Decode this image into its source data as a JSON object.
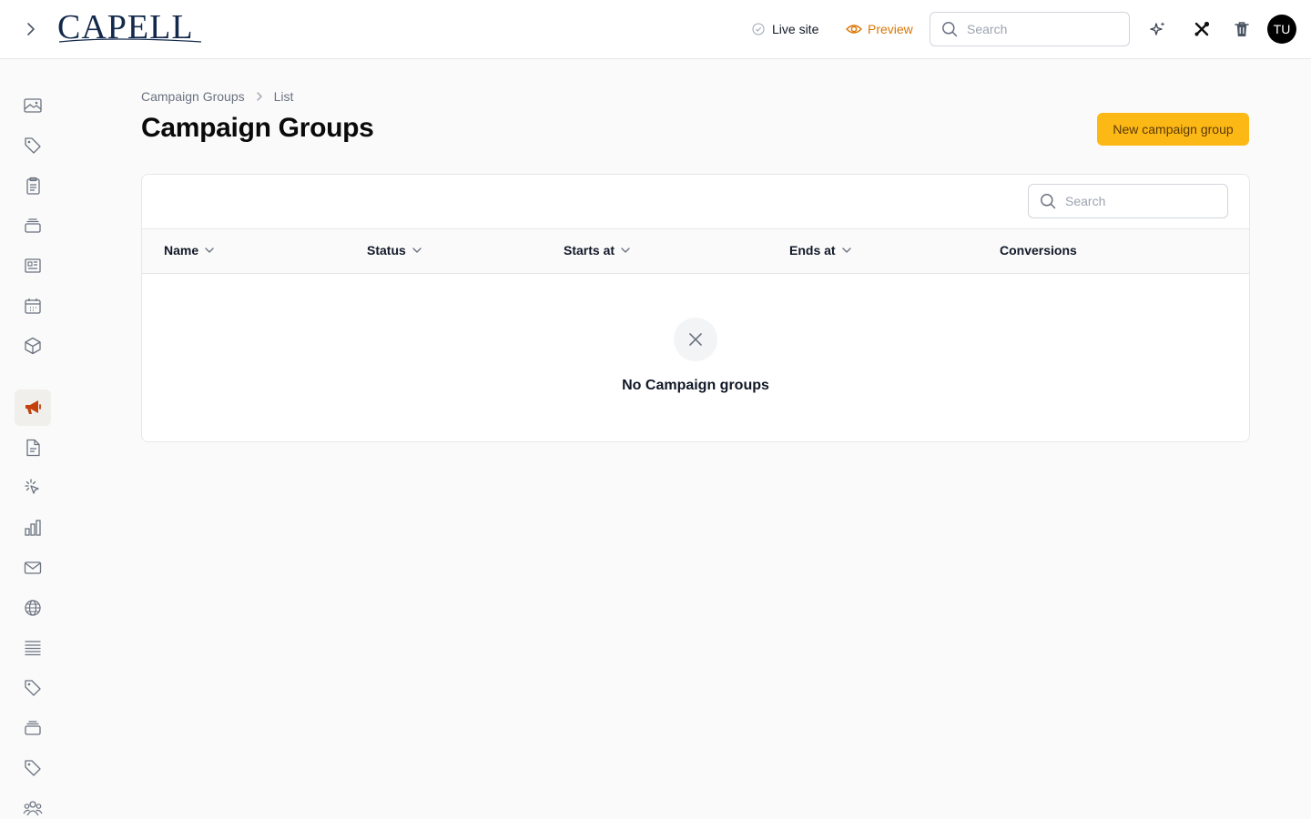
{
  "brand": {
    "logo_text": "CAPELL"
  },
  "header": {
    "live_site_label": "Live site",
    "preview_label": "Preview",
    "search_placeholder": "Search",
    "avatar_initials": "TU",
    "accent_color": "#d97706"
  },
  "sidebar": {
    "items": [
      {
        "name": "media",
        "icon": "image-icon"
      },
      {
        "name": "tags",
        "icon": "tag-icon"
      },
      {
        "name": "clipboard",
        "icon": "clipboard-icon"
      },
      {
        "name": "collections",
        "icon": "stack-icon"
      },
      {
        "name": "news",
        "icon": "newspaper-icon"
      },
      {
        "name": "events",
        "icon": "calendar-icon"
      },
      {
        "name": "products",
        "icon": "cube-icon"
      },
      {
        "name": "campaigns",
        "icon": "megaphone-icon",
        "active": true
      },
      {
        "name": "documents",
        "icon": "document-icon"
      },
      {
        "name": "clicks",
        "icon": "cursor-click-icon"
      },
      {
        "name": "analytics",
        "icon": "bar-chart-icon"
      },
      {
        "name": "mail",
        "icon": "envelope-icon"
      },
      {
        "name": "sites",
        "icon": "globe-icon"
      },
      {
        "name": "lists",
        "icon": "list-icon"
      },
      {
        "name": "labels",
        "icon": "tag-icon"
      },
      {
        "name": "archive",
        "icon": "stack-icon"
      },
      {
        "name": "categories",
        "icon": "tag-icon"
      },
      {
        "name": "users",
        "icon": "users-icon"
      }
    ],
    "active_color": "#c2410c"
  },
  "page": {
    "breadcrumb": [
      "Campaign Groups",
      "List"
    ],
    "title": "Campaign Groups",
    "new_button_label": "New campaign group",
    "button_color": "#fcb815"
  },
  "table": {
    "search_placeholder": "Search",
    "columns": [
      "Name",
      "Status",
      "Starts at",
      "Ends at",
      "Conversions"
    ],
    "sortable": [
      true,
      true,
      true,
      true,
      false
    ],
    "rows": [],
    "empty_message": "No Campaign groups"
  }
}
